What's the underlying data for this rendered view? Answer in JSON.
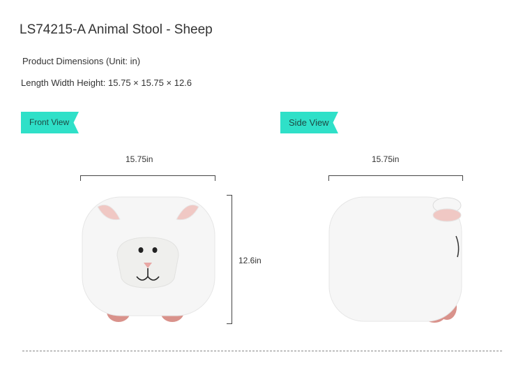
{
  "product": {
    "title": "LS74215-A Animal Stool - Sheep",
    "dimensions_heading": "Product Dimensions (Unit: in)",
    "dimensions_line": "Length Width Height: 15.75 × 15.75 × 12.6"
  },
  "views": {
    "front": {
      "label": "Front View",
      "width_label": "15.75in",
      "height_label": "12.6in"
    },
    "side": {
      "label": "Side View",
      "width_label": "15.75in"
    }
  },
  "colors": {
    "tag_bg": "#2fe0c8",
    "stool_body": "#f6f6f6",
    "ear_inner": "#f0c8c4",
    "nose": "#e8a7a4",
    "feet": "#d9928b"
  }
}
